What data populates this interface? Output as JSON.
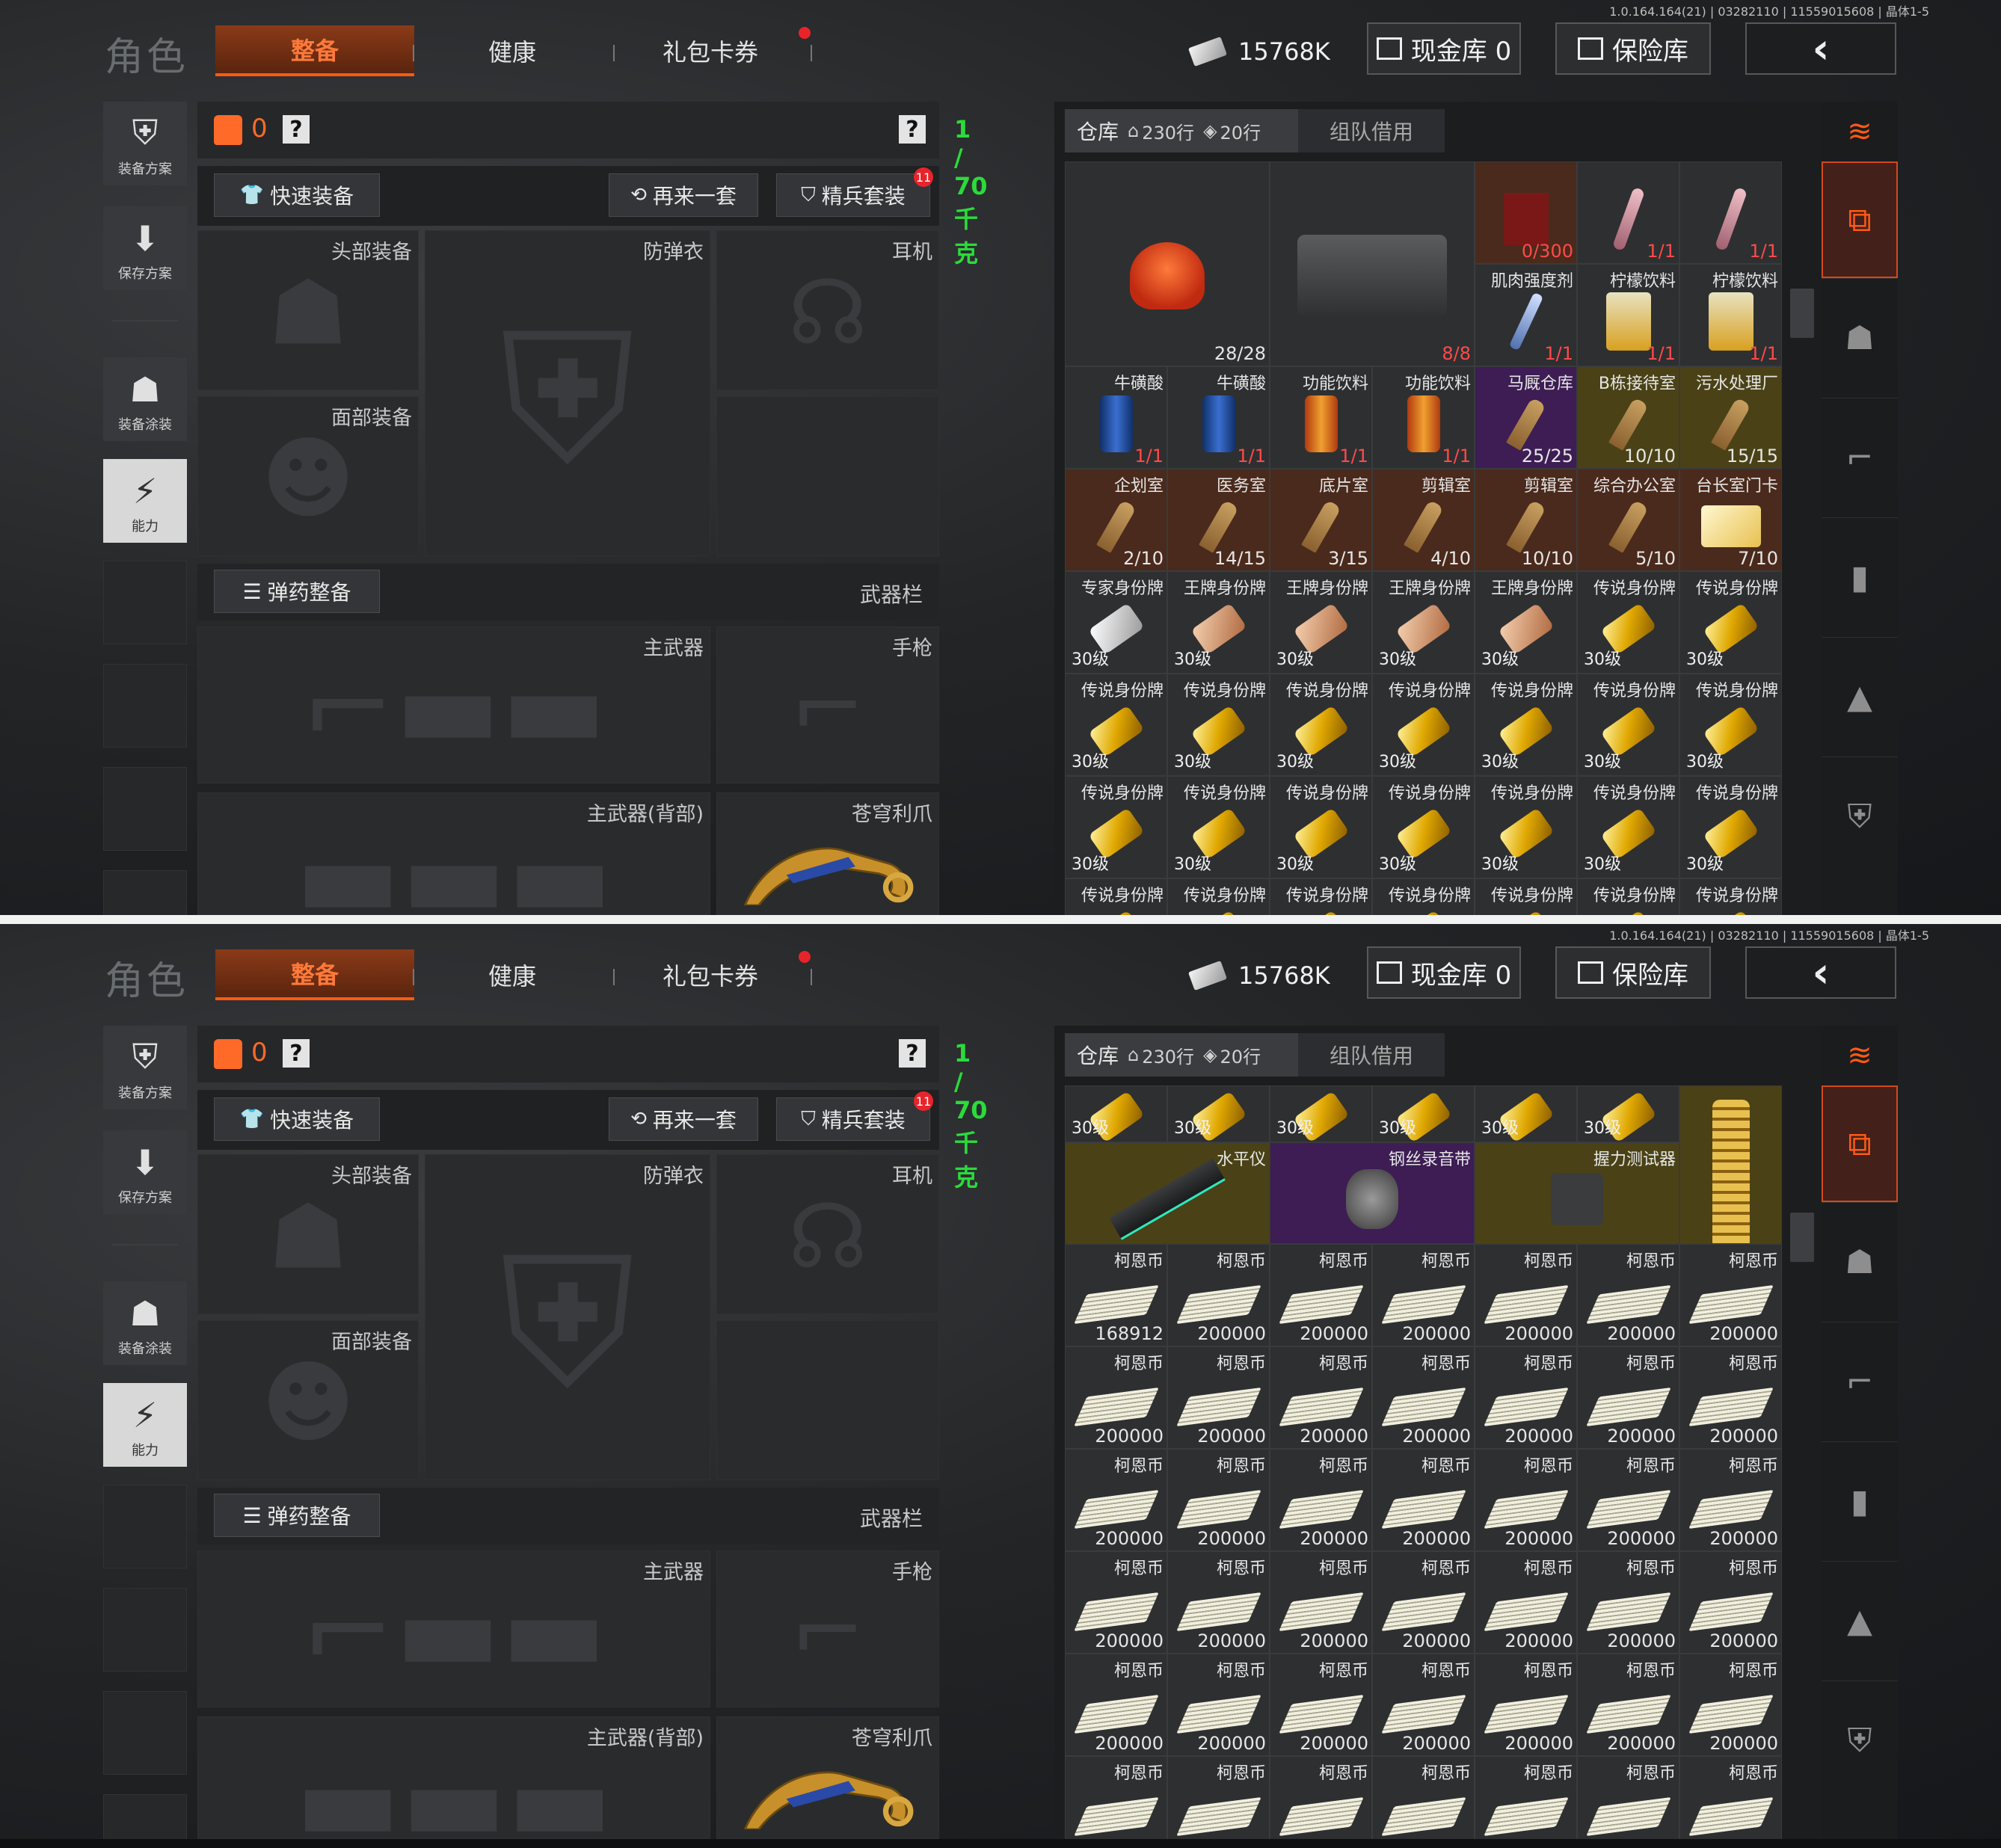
{
  "version": "1.0.164.164(21) | 03282110 | 11559015608 | 晶体1-5",
  "header": {
    "role": "角色",
    "tabs": [
      "整备",
      "健康",
      "礼包卡券"
    ],
    "money": "15768K",
    "cash_vault": "现金库 0",
    "safe": "保险库",
    "back": "‹"
  },
  "rail": {
    "scheme": "装备方案",
    "save": "保存方案",
    "paint": "装备涂装",
    "ability": "能力"
  },
  "equip": {
    "count": "0",
    "help": "?",
    "weight": "1 / 70 千克",
    "quick": "快速装备",
    "again": "再来一套",
    "elite": "精兵套装",
    "badge": "11",
    "slots": {
      "head": "头部装备",
      "armor": "防弹衣",
      "ear": "耳机",
      "face": "面部装备",
      "weapons": "武器栏",
      "ammo": "弹药整备",
      "primary": "主武器",
      "pistol": "手枪",
      "primary_back": "主武器(背部)",
      "melee": "苍穹利爪"
    }
  },
  "warehouse": {
    "tab": "仓库",
    "rows": "230行",
    "tickets": "20行",
    "team": "组队借用"
  },
  "screen1_cells": [
    {
      "nm": "",
      "q": "28/28",
      "cls": "",
      "art": "hat",
      "w": 2,
      "h": 2
    },
    {
      "nm": "",
      "q": "8/8",
      "qred": true,
      "cls": "",
      "art": "bag",
      "w": 2,
      "h": 2
    },
    {
      "nm": "",
      "q": "0/300",
      "qred": true,
      "cls": "red",
      "art": "box"
    },
    {
      "nm": "",
      "q": "1/1",
      "qred": true,
      "cls": "",
      "art": "tube"
    },
    {
      "nm": "",
      "q": "1/1",
      "qred": true,
      "cls": "",
      "art": "tube"
    },
    {
      "nm": "肌肉强度剂",
      "q": "1/1",
      "qred": true,
      "cls": "",
      "art": "syr"
    },
    {
      "nm": "柠檬饮料",
      "q": "1/1",
      "qred": true,
      "cls": "",
      "art": "drink"
    },
    {
      "nm": "柠檬饮料",
      "q": "1/1",
      "qred": true,
      "cls": "",
      "art": "drink"
    },
    {
      "nm": "牛磺酸",
      "q": "1/1",
      "qred": true,
      "cls": "",
      "art": "can-blue"
    },
    {
      "nm": "牛磺酸",
      "q": "1/1",
      "qred": true,
      "cls": "",
      "art": "can-blue"
    },
    {
      "nm": "功能饮料",
      "q": "1/1",
      "qred": true,
      "cls": "",
      "art": "can-orange"
    },
    {
      "nm": "功能饮料",
      "q": "1/1",
      "qred": true,
      "cls": "",
      "art": "can-orange"
    },
    {
      "nm": "马厩仓库",
      "q": "25/25",
      "cls": "purple",
      "art": "key"
    },
    {
      "nm": "B栋接待室",
      "q": "10/10",
      "cls": "gold",
      "art": "key"
    },
    {
      "nm": "污水处理厂",
      "q": "15/15",
      "cls": "gold",
      "art": "key"
    },
    {
      "nm": "企划室",
      "q": "2/10",
      "cls": "red",
      "art": "key"
    },
    {
      "nm": "医务室",
      "q": "14/15",
      "cls": "red",
      "art": "key"
    },
    {
      "nm": "底片室",
      "q": "3/15",
      "cls": "red",
      "art": "key"
    },
    {
      "nm": "剪辑室",
      "q": "4/10",
      "cls": "red",
      "art": "key"
    },
    {
      "nm": "剪辑室",
      "q": "10/10",
      "cls": "red",
      "art": "key"
    },
    {
      "nm": "综合办公室",
      "q": "5/10",
      "cls": "red",
      "art": "key"
    },
    {
      "nm": "台长室门卡",
      "q": "7/10",
      "cls": "red",
      "art": "card"
    },
    {
      "nm": "专家身份牌",
      "lv": "30级",
      "cls": "",
      "art": "tag-silver"
    },
    {
      "nm": "王牌身份牌",
      "lv": "30级",
      "cls": "",
      "art": "tag-copper"
    },
    {
      "nm": "王牌身份牌",
      "lv": "30级",
      "cls": "",
      "art": "tag-copper"
    },
    {
      "nm": "王牌身份牌",
      "lv": "30级",
      "cls": "",
      "art": "tag-copper"
    },
    {
      "nm": "王牌身份牌",
      "lv": "30级",
      "cls": "",
      "art": "tag-copper"
    },
    {
      "nm": "传说身份牌",
      "lv": "30级",
      "cls": "",
      "art": "tag"
    },
    {
      "nm": "传说身份牌",
      "lv": "30级",
      "cls": "",
      "art": "tag"
    },
    {
      "nm": "传说身份牌",
      "lv": "30级",
      "cls": "",
      "art": "tag"
    },
    {
      "nm": "传说身份牌",
      "lv": "30级",
      "cls": "",
      "art": "tag"
    },
    {
      "nm": "传说身份牌",
      "lv": "30级",
      "cls": "",
      "art": "tag"
    },
    {
      "nm": "传说身份牌",
      "lv": "30级",
      "cls": "",
      "art": "tag"
    },
    {
      "nm": "传说身份牌",
      "lv": "30级",
      "cls": "",
      "art": "tag"
    },
    {
      "nm": "传说身份牌",
      "lv": "30级",
      "cls": "",
      "art": "tag"
    },
    {
      "nm": "传说身份牌",
      "lv": "30级",
      "cls": "",
      "art": "tag"
    },
    {
      "nm": "传说身份牌",
      "lv": "30级",
      "cls": "",
      "art": "tag"
    },
    {
      "nm": "传说身份牌",
      "lv": "30级",
      "cls": "",
      "art": "tag"
    },
    {
      "nm": "传说身份牌",
      "lv": "30级",
      "cls": "",
      "art": "tag"
    },
    {
      "nm": "传说身份牌",
      "lv": "30级",
      "cls": "",
      "art": "tag"
    },
    {
      "nm": "传说身份牌",
      "lv": "30级",
      "cls": "",
      "art": "tag"
    },
    {
      "nm": "传说身份牌",
      "lv": "30级",
      "cls": "",
      "art": "tag"
    },
    {
      "nm": "传说身份牌",
      "lv": "30级",
      "cls": "",
      "art": "tag"
    },
    {
      "nm": "传说身份牌",
      "lv": "30级",
      "cls": "",
      "art": "tag"
    },
    {
      "nm": "传说身份牌",
      "lv": "30级",
      "cls": "",
      "art": "tag"
    },
    {
      "nm": "传说身份牌",
      "lv": "30级",
      "cls": "",
      "art": "tag"
    },
    {
      "nm": "传说身份牌",
      "lv": "30级",
      "cls": "",
      "art": "tag"
    },
    {
      "nm": "传说身份牌",
      "lv": "30级",
      "cls": "",
      "art": "tag"
    },
    {
      "nm": "传说身份牌",
      "lv": "30级",
      "cls": "",
      "art": "tag"
    },
    {
      "nm": "传说身份牌",
      "lv": "30级",
      "cls": "",
      "art": "tag"
    },
    {
      "nm": "传说身份牌",
      "lv": "30级",
      "cls": "",
      "art": "tag"
    },
    {
      "nm": "传说身份牌",
      "lv": "30级",
      "cls": "",
      "art": "tag"
    },
    {
      "nm": "金链",
      "lv": "",
      "cls": "gold",
      "art": "chain"
    }
  ],
  "screen2_top": [
    {
      "nm": "",
      "lv": "30级",
      "art": "tag"
    },
    {
      "nm": "",
      "lv": "30级",
      "art": "tag"
    },
    {
      "nm": "",
      "lv": "30级",
      "art": "tag"
    },
    {
      "nm": "",
      "lv": "30级",
      "art": "tag"
    },
    {
      "nm": "",
      "lv": "30级",
      "art": "tag"
    },
    {
      "nm": "",
      "lv": "30级",
      "art": "tag"
    }
  ],
  "screen2_wide": [
    {
      "nm": "水平仪",
      "cls": "gold",
      "art": "level"
    },
    {
      "nm": "钢丝录音带",
      "cls": "purple",
      "art": "tape"
    },
    {
      "nm": "握力测试器",
      "cls": "gold",
      "art": "grip"
    }
  ],
  "coin_name": "柯恩币",
  "coin_first": "168912",
  "coin_full": "200000",
  "icons": {
    "vest": "vest-icon",
    "help": "help-icon",
    "bill": "bill-icon",
    "vault": "vault-icon",
    "safe": "safe-icon",
    "back": "back-icon"
  }
}
